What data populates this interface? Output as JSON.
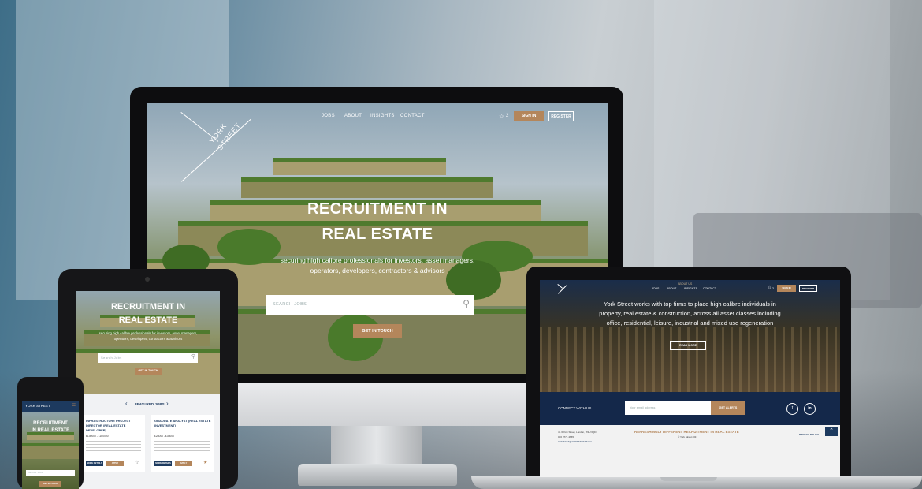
{
  "colors": {
    "gold": "#b4865b",
    "navy": "#1d3a5f",
    "dark_blue": "#14284a",
    "white": "#ffffff"
  },
  "imac": {
    "logo": {
      "line1": "YORK",
      "line2": "STREET"
    },
    "nav": [
      "JOBS",
      "ABOUT",
      "INSIGHTS",
      "CONTACT"
    ],
    "shortlist_icon": "star-icon",
    "shortlist_count": "2",
    "sign_in": "SIGN IN",
    "register": "REGISTER",
    "hero_title_line1": "RECRUITMENT IN",
    "hero_title_line2": "REAL ESTATE",
    "hero_sub_line1": "securing high calibre professionals for investors, asset managers,",
    "hero_sub_line2": "operators, developers, contractors & advisors",
    "search_placeholder": "SEARCH JOBS",
    "get_in_touch": "GET IN TOUCH"
  },
  "ipad": {
    "hero_title_line1": "RECRUITMENT IN",
    "hero_title_line2": "REAL ESTATE",
    "hero_sub_line1": "securing high calibre professionals for investors, asset managers,",
    "hero_sub_line2": "operators, developers, contractors & advisors",
    "search_placeholder": "Search Jobs",
    "get_in_touch": "GET IN TOUCH",
    "featured_jobs": "FEATURED JOBS",
    "jobs": [
      {
        "title_line1": "INFRASTRUCTURE PROJECT",
        "title_line2": "DIRECTOR (REAL ESTATE",
        "title_line3": "DEVELOPER)",
        "salary": "£130000 - £160000",
        "more": "MORE DETAILS",
        "apply": "APPLY"
      },
      {
        "title_line1": "GRADUATE ANALYST (REAL ESTATE",
        "title_line2": "INVESTMENT)",
        "title_line3": "",
        "salary": "£28000 - £35000",
        "more": "MORE DETAILS",
        "apply": "APPLY"
      }
    ]
  },
  "iphone": {
    "logo": "YORK STREET",
    "hero_title_line1": "RECRUITMENT",
    "hero_title_line2": "IN REAL ESTATE",
    "search_placeholder": "Search Jobs",
    "get_in_touch": "GET IN TOUCH"
  },
  "macbook": {
    "nav": [
      "JOBS",
      "ABOUT",
      "INSIGHTS",
      "CONTACT"
    ],
    "sub_nav": "ABOUT US",
    "shortlist_count": "2",
    "sign_in": "SIGN IN",
    "register": "REGISTER",
    "about_line1": "York Street works with top firms to place high calibre individuals in",
    "about_line2": "property, real estate & construction, across all asset classes including",
    "about_line3": "office, residential, leisure, industrial and mixed use regeneration",
    "read_more": "READ MORE",
    "connect": "CONNECT WITH US",
    "email_placeholder": "Your email address",
    "get_alerts": "GET ALERTS",
    "footer_tagline": "REFRESHINGLY DIFFERENT RECRUITMENT IN REAL ESTATE",
    "address": "4 - 6 York Street, London, W1U 6QD",
    "copyright": "© York Street 2017",
    "phone": "020 3771 4665",
    "email": "CONTACT@YORKSTREET.CO",
    "privacy": "PRIVACY POLICY"
  }
}
